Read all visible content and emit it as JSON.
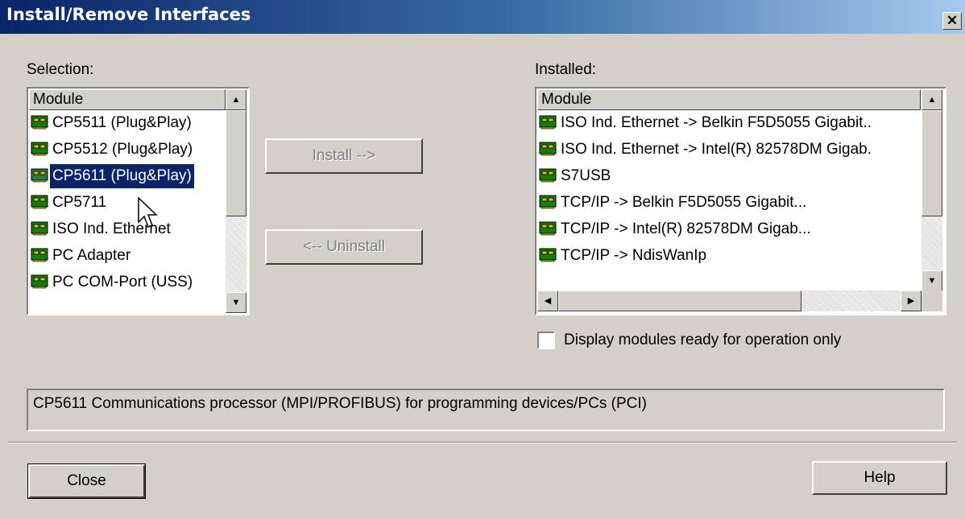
{
  "window": {
    "title": "Install/Remove Interfaces",
    "close_glyph": "✕"
  },
  "selection": {
    "label": "Selection:",
    "column_header": "Module",
    "items": [
      {
        "label": "CP5511 (Plug&Play)",
        "icon": "module-card-icon"
      },
      {
        "label": "CP5512 (Plug&Play)",
        "icon": "module-card-icon"
      },
      {
        "label": "CP5611 (Plug&Play)",
        "icon": "module-card-icon",
        "selected": true
      },
      {
        "label": "CP5711",
        "icon": "module-card-icon"
      },
      {
        "label": "ISO Ind. Ethernet",
        "icon": "module-card-icon"
      },
      {
        "label": "PC Adapter",
        "icon": "module-card-icon"
      },
      {
        "label": "PC COM-Port (USS)",
        "icon": "module-card-icon"
      }
    ]
  },
  "installed": {
    "label": "Installed:",
    "column_header": "Module",
    "items": [
      {
        "label": "ISO Ind. Ethernet -> Belkin F5D5055 Gigabit..",
        "icon": "module-card-icon"
      },
      {
        "label": "ISO Ind. Ethernet -> Intel(R) 82578DM Gigab.",
        "icon": "module-card-icon"
      },
      {
        "label": "S7USB",
        "icon": "module-card-icon"
      },
      {
        "label": "TCP/IP -> Belkin F5D5055 Gigabit...",
        "icon": "module-card-icon"
      },
      {
        "label": "TCP/IP -> Intel(R) 82578DM Gigab...",
        "icon": "module-card-icon"
      },
      {
        "label": "TCP/IP -> NdisWanIp",
        "icon": "module-card-icon"
      }
    ]
  },
  "buttons": {
    "install": "Install -->",
    "uninstall": "<-- Uninstall",
    "close": "Close",
    "help": "Help"
  },
  "checkbox": {
    "label": "Display modules ready for operation only",
    "checked": false
  },
  "description": "CP5611 Communications processor (MPI/PROFIBUS) for programming devices/PCs (PCI)"
}
